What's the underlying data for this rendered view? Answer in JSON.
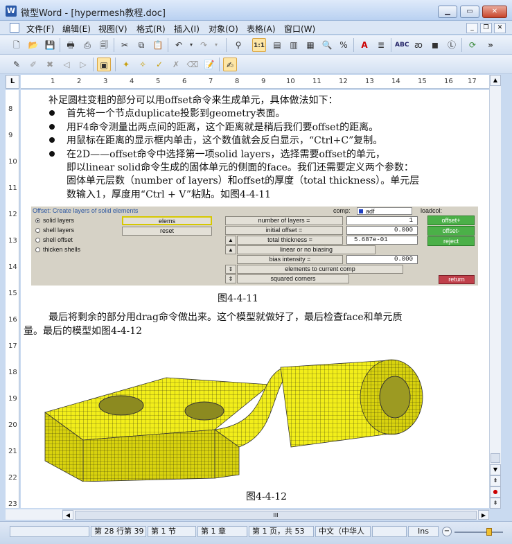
{
  "window": {
    "title": "微型Word - [hypermesh教程.doc]",
    "app_icon": "W"
  },
  "menu": [
    "文件(F)",
    "编辑(E)",
    "视图(V)",
    "格式(R)",
    "插入(I)",
    "对象(O)",
    "表格(A)",
    "窗口(W)"
  ],
  "ruler": {
    "corner": "L",
    "numbers": [
      "1",
      "2",
      "3",
      "4",
      "5",
      "6",
      "7",
      "8",
      "9",
      "10",
      "11",
      "12",
      "13",
      "14",
      "15",
      "16",
      "17"
    ]
  },
  "vruler": [
    "8",
    "9",
    "10",
    "11",
    "12",
    "13",
    "14",
    "15",
    "16",
    "17",
    "18",
    "19",
    "20",
    "21",
    "22",
    "23"
  ],
  "doc": {
    "intro": "补足圆柱变粗的部分可以用offset命令来生成单元，具体做法如下：",
    "bullets": [
      "首先将一个节点duplicate投影到geometry表面。",
      "用F4命令测量出两点间的距离，这个距离就是稍后我们要offset的距离。",
      "用鼠标在距离的显示框内单击，这个数值就会反白显示，“Ctrl+C”复制。",
      "在2D——offset命令中选择第一项solid layers，选择需要offset的单元，"
    ],
    "bullet4_cont": [
      "即以linear solid命令生成的固体单元的侧面的face。我们还需要定义两个参数：",
      "固体单元层数（number of layers）和offset的厚度（total thickness）。单元层",
      "数输入1，厚度用“Ctrl + V”粘贴。如图4-4-11"
    ],
    "caption1": "图4-4-11",
    "para2_line1": "最后将剩余的部分用drag命令做出来。这个模型就做好了，最后检查face和单元质",
    "para2_line2": "量。最后的模型如图4-4-12",
    "caption2": "图4-4-12"
  },
  "panel": {
    "title": "Offset: Create layers of solid elements",
    "comp_label": "comp:",
    "comp_value": "adf",
    "loadcol_label": "loadcol:",
    "radios": [
      "solid layers",
      "shell layers",
      "shell offset",
      "thicken shells"
    ],
    "elems": "elems",
    "reset": "reset",
    "number_of_layers_label": "number of layers  =",
    "number_of_layers": "1",
    "initial_offset_label": "initial offset   =",
    "initial_offset": "0.000",
    "total_thickness_label": "total thickness =",
    "total_thickness": "5.687e-01",
    "biasing": "linear or no biasing",
    "bias_intensity_label": "bias intensity   =",
    "bias_intensity": "0.000",
    "elements_to_current_comp": "elements to current comp",
    "squared_corners": "squared corners",
    "offset_plus": "offset+",
    "offset_minus": "offset-",
    "reject": "reject",
    "return": "return"
  },
  "hscroll_grip": "III",
  "status": {
    "pos": "第 28 行第 39",
    "section": "第 1 节",
    "chapter": "第 1 章",
    "page": "第 1 页，共 53",
    "lang": "中文（中华人",
    "ins": "Ins"
  }
}
